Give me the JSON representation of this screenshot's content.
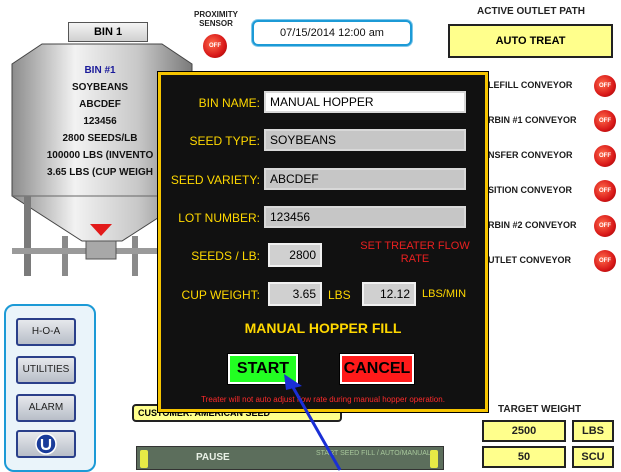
{
  "background": {
    "bin_tab": "BIN 1",
    "bin_info": [
      "BIN #1",
      "SOYBEANS",
      "ABCDEF",
      "123456",
      "2800 SEEDS/LB",
      "100000 LBS (INVENTO",
      "3.65 LBS (CUP WEIGH"
    ],
    "proximity_label": "PROXIMITY SENSOR",
    "proximity_state": "OFF",
    "datetime": "07/15/2014  12:00 am",
    "outlet_title": "ACTIVE OUTLET PATH",
    "outlet_mode": "AUTO TREAT",
    "conveyors": [
      {
        "label": "LEFILL CONVEYOR",
        "state": "OFF"
      },
      {
        "label": "RBIN #1 CONVEYOR",
        "state": "OFF"
      },
      {
        "label": "NSFER CONVEYOR",
        "state": "OFF"
      },
      {
        "label": "SITION CONVEYOR",
        "state": "OFF"
      },
      {
        "label": "RBIN #2 CONVEYOR",
        "state": "OFF"
      },
      {
        "label": "UTLET CONVEYOR",
        "state": "OFF"
      }
    ],
    "side_buttons": [
      "H-O-A",
      "UTILITIES",
      "ALARM"
    ],
    "customer": "CUSTOMER: AMERICAN SEED",
    "pause_label": "PAUSE",
    "pause_faint": "START SEED FILL / AUTO/MANUAL",
    "target_title": "TARGET WEIGHT",
    "target_weight": "2500",
    "target_weight_unit": "LBS",
    "target_scu": "50",
    "target_scu_unit": "SCU"
  },
  "modal": {
    "bin_name_label": "BIN NAME:",
    "bin_name_value": "MANUAL HOPPER",
    "seed_type_label": "SEED TYPE:",
    "seed_type_value": "SOYBEANS",
    "seed_variety_label": "SEED VARIETY:",
    "seed_variety_value": "ABCDEF",
    "lot_number_label": "LOT NUMBER:",
    "lot_number_value": "123456",
    "seeds_per_lb_label": "SEEDS / LB:",
    "seeds_per_lb_value": "2800",
    "set_treater_label": "SET TREATER FLOW RATE",
    "cup_weight_label": "CUP WEIGHT:",
    "cup_weight_value": "3.65",
    "cup_weight_unit": "LBS",
    "flow_rate_value": "12.12",
    "flow_rate_unit": "LBS/MIN",
    "title": "MANUAL HOPPER FILL",
    "start_label": "START",
    "cancel_label": "CANCEL",
    "warning": "Treater will not auto adjust flow rate during manual hopper operation."
  },
  "colors": {
    "modal_bg": "#111111",
    "modal_border": "#f5c400",
    "label_yellow": "#ffd800",
    "start_green": "#22ff22",
    "cancel_red": "#ff1a1a",
    "accent_blue": "#1c9ad6",
    "field_yellow": "#ffff8c"
  }
}
